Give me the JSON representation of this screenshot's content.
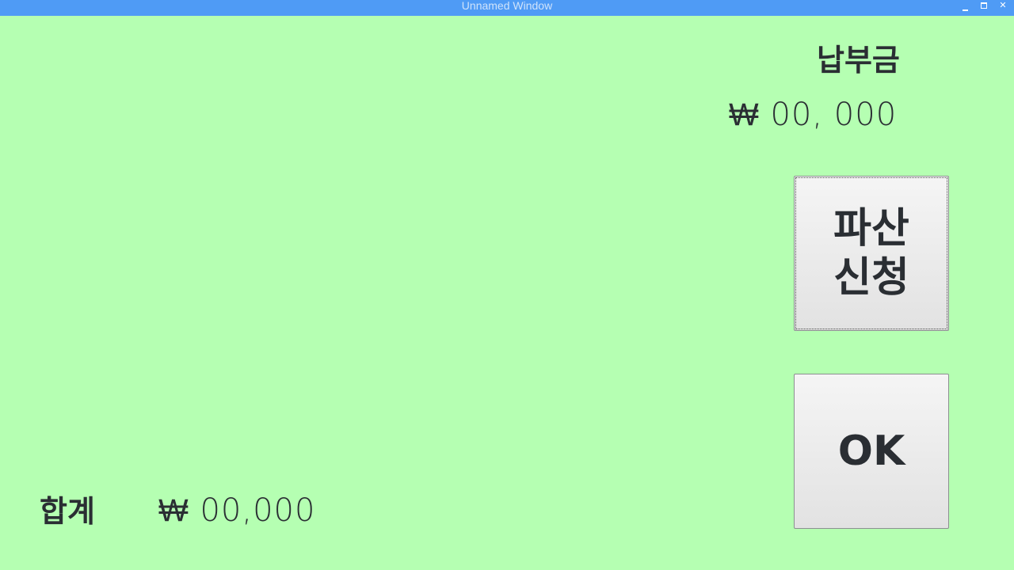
{
  "window": {
    "title": "Unnamed Window",
    "controls": {
      "minimize_icon": "minimize-icon",
      "maximize_icon": "maximize-icon",
      "close_icon": "close-icon",
      "close_glyph": "✕"
    },
    "title_bar_color": "#4f9bf5",
    "background_color": "#b5ffb2"
  },
  "payment": {
    "label": "납부금",
    "amount": "₩ 00, 000"
  },
  "buttons": {
    "bankruptcy_label": "파산\n신청",
    "ok_label": "OK"
  },
  "total": {
    "label": "합계",
    "amount": "₩ 00,000"
  }
}
